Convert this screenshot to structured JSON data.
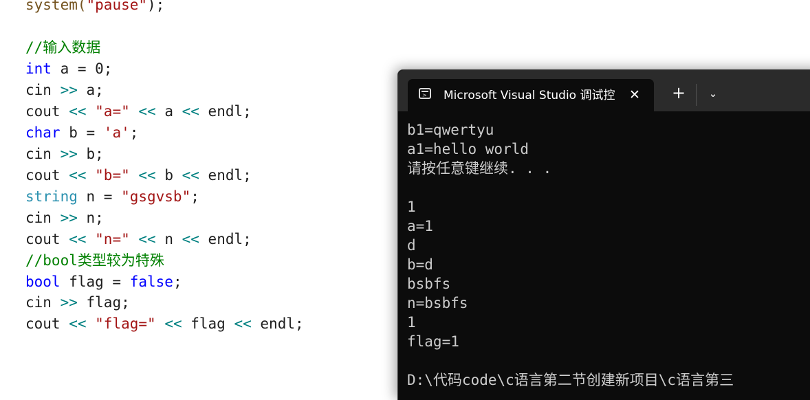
{
  "editor": {
    "lines": [
      [
        {
          "t": "system(",
          "c": "fn"
        },
        {
          "t": "\"pause\"",
          "c": "str"
        },
        {
          "t": ");",
          "c": "pl"
        }
      ],
      [],
      [
        {
          "t": "//输入数据",
          "c": "cmt"
        }
      ],
      [
        {
          "t": "int",
          "c": "kw"
        },
        {
          "t": " a = 0;",
          "c": "pl"
        }
      ],
      [
        {
          "t": "cin ",
          "c": "pl"
        },
        {
          "t": ">>",
          "c": "op"
        },
        {
          "t": " a;",
          "c": "pl"
        }
      ],
      [
        {
          "t": "cout ",
          "c": "pl"
        },
        {
          "t": "<<",
          "c": "op"
        },
        {
          "t": " \"a=\" ",
          "c": "str"
        },
        {
          "t": "<<",
          "c": "op"
        },
        {
          "t": " a ",
          "c": "pl"
        },
        {
          "t": "<<",
          "c": "op"
        },
        {
          "t": " endl;",
          "c": "pl"
        }
      ],
      [
        {
          "t": "char",
          "c": "kw"
        },
        {
          "t": " b = ",
          "c": "pl"
        },
        {
          "t": "'a'",
          "c": "str"
        },
        {
          "t": ";",
          "c": "pl"
        }
      ],
      [
        {
          "t": "cin ",
          "c": "pl"
        },
        {
          "t": ">>",
          "c": "op"
        },
        {
          "t": " b;",
          "c": "pl"
        }
      ],
      [
        {
          "t": "cout ",
          "c": "pl"
        },
        {
          "t": "<<",
          "c": "op"
        },
        {
          "t": " \"b=\" ",
          "c": "str"
        },
        {
          "t": "<<",
          "c": "op"
        },
        {
          "t": " b ",
          "c": "pl"
        },
        {
          "t": "<<",
          "c": "op"
        },
        {
          "t": " endl;",
          "c": "pl"
        }
      ],
      [
        {
          "t": "string",
          "c": "type"
        },
        {
          "t": " n = ",
          "c": "pl"
        },
        {
          "t": "\"gsgvsb\"",
          "c": "str"
        },
        {
          "t": ";",
          "c": "pl"
        }
      ],
      [
        {
          "t": "cin ",
          "c": "pl"
        },
        {
          "t": ">>",
          "c": "op"
        },
        {
          "t": " n;",
          "c": "pl"
        }
      ],
      [
        {
          "t": "cout ",
          "c": "pl"
        },
        {
          "t": "<<",
          "c": "op"
        },
        {
          "t": " \"n=\" ",
          "c": "str"
        },
        {
          "t": "<<",
          "c": "op"
        },
        {
          "t": " n ",
          "c": "pl"
        },
        {
          "t": "<<",
          "c": "op"
        },
        {
          "t": " endl;",
          "c": "pl"
        }
      ],
      [
        {
          "t": "//bool类型较为特殊",
          "c": "cmt"
        }
      ],
      [
        {
          "t": "bool",
          "c": "kw"
        },
        {
          "t": " flag = ",
          "c": "pl"
        },
        {
          "t": "false",
          "c": "kw"
        },
        {
          "t": ";",
          "c": "pl"
        }
      ],
      [
        {
          "t": "cin ",
          "c": "pl"
        },
        {
          "t": ">>",
          "c": "op"
        },
        {
          "t": " flag;",
          "c": "pl"
        }
      ],
      [
        {
          "t": "cout ",
          "c": "pl"
        },
        {
          "t": "<<",
          "c": "op"
        },
        {
          "t": " \"flag=\" ",
          "c": "str"
        },
        {
          "t": "<<",
          "c": "op"
        },
        {
          "t": " flag ",
          "c": "pl"
        },
        {
          "t": "<<",
          "c": "op"
        },
        {
          "t": " endl;",
          "c": "pl"
        }
      ]
    ]
  },
  "terminal": {
    "tab_title": "Microsoft Visual Studio 调试控制台",
    "icon": "console-icon",
    "close_glyph": "✕",
    "new_tab_glyph": "+",
    "dropdown_glyph": "⌄",
    "lines": [
      "b1=qwertyu",
      "a1=hello world",
      "请按任意键继续. . .",
      "",
      "1",
      "a=1",
      "d",
      "b=d",
      "bsbfs",
      "n=bsbfs",
      "1",
      "flag=1",
      "",
      "D:\\代码code\\c语言第二节创建新项目\\c语言第三"
    ]
  }
}
